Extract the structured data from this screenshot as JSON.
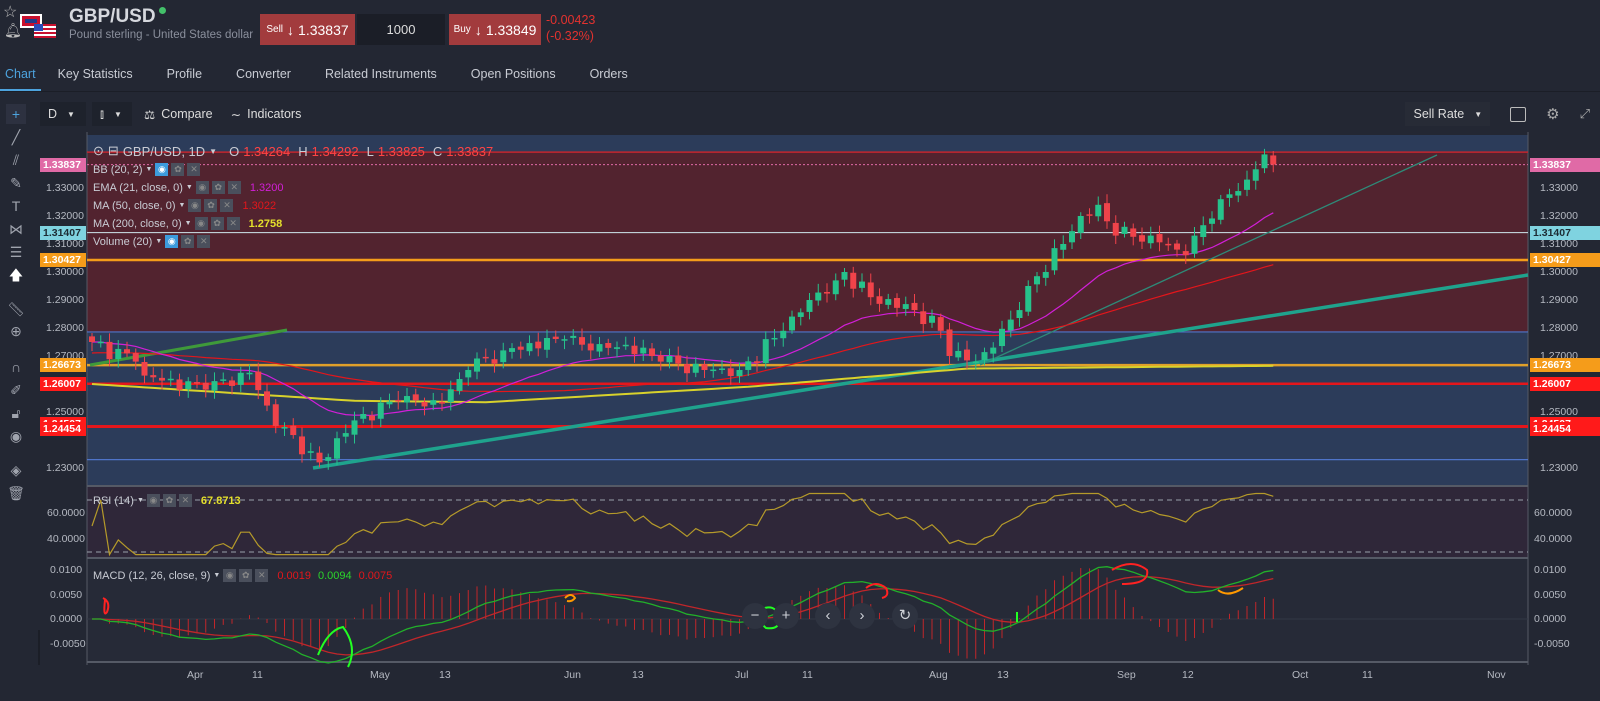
{
  "header": {
    "symbol": "GBP/USD",
    "name": "Pound sterling - United States dollar",
    "sell_label": "Sell",
    "sell_price": "1.33837",
    "quantity": "1000",
    "buy_label": "Buy",
    "buy_price": "1.33849",
    "change": "-0.00423",
    "change_pct": "(-0.32%)",
    "arrow": "↓"
  },
  "tabs": [
    "Chart",
    "Key Statistics",
    "Profile",
    "Converter",
    "Related Instruments",
    "Open Positions",
    "Orders"
  ],
  "toolbar": {
    "interval": "D",
    "compare": "Compare",
    "indicators": "Indicators",
    "rate": "Sell Rate"
  },
  "legend": {
    "title": "GBP/USD, 1D",
    "o_label": "O",
    "o": "1.34264",
    "h_label": "H",
    "h": "1.34292",
    "l_label": "L",
    "l": "1.33825",
    "c_label": "C",
    "c": "1.33837",
    "bb": "BB (20, 2)",
    "ema": "EMA (21, close, 0)",
    "ema_val": "1.3200",
    "ma50": "MA (50, close, 0)",
    "ma50_val": "1.3022",
    "ma200": "MA (200, close, 0)",
    "ma200_val": "1.2758",
    "volume": "Volume (20)",
    "rsi": "RSI (14)",
    "rsi_val": "67.8713",
    "macd": "MACD (12, 26, close, 9)",
    "macd_hist": "0.0019",
    "macd_line": "0.0094",
    "macd_signal": "0.0075"
  },
  "price_axis": [
    "1.33000",
    "1.32000",
    "1.31000",
    "1.30000",
    "1.29000",
    "1.28000",
    "1.27000",
    "1.25000",
    "1.23000"
  ],
  "price_tags": [
    {
      "text": "1.33837",
      "bg": "#e06aa6",
      "fg": "#fff"
    },
    {
      "text": "1.31407",
      "bg": "#7fd3e0",
      "fg": "#1c2b33"
    },
    {
      "text": "1.30427",
      "bg": "#f59c1a",
      "fg": "#fff"
    },
    {
      "text": "1.26673",
      "bg": "#f59c1a",
      "fg": "#fff"
    },
    {
      "text": "1.26007",
      "bg": "#ff1a1a",
      "fg": "#fff"
    },
    {
      "text": "1.24507",
      "bg": "#ff1a1a",
      "fg": "#fff"
    },
    {
      "text": "1.24454",
      "bg": "#ff1a1a",
      "fg": "#fff"
    }
  ],
  "rsi_axis": [
    "60.0000",
    "40.0000"
  ],
  "macd_axis": [
    "0.0100",
    "0.0050",
    "0.0000",
    "-0.0050"
  ],
  "x_axis": [
    "Apr",
    "11",
    "May",
    "13",
    "Jun",
    "13",
    "Jul",
    "11",
    "Aug",
    "13",
    "Sep",
    "12",
    "Oct",
    "11",
    "Nov"
  ],
  "colors": {
    "up": "#26c28b",
    "down": "#f0434a",
    "ema": "#d21fd8",
    "ma50": "#e3161b",
    "ma200": "#d8d22c",
    "rsi": "#b59a2a",
    "macd": "#22b02a",
    "signal": "#c0262a"
  },
  "chart_data": {
    "type": "candlestick",
    "symbol": "GBP/USD",
    "interval": "1D",
    "close_waypoints": [
      [
        0,
        1.275
      ],
      [
        5,
        1.268
      ],
      [
        6,
        1.263
      ],
      [
        13,
        1.258
      ],
      [
        18,
        1.264
      ],
      [
        21,
        1.245
      ],
      [
        25,
        1.236
      ],
      [
        26,
        1.232
      ],
      [
        30,
        1.247
      ],
      [
        35,
        1.254
      ],
      [
        40,
        1.253
      ],
      [
        43,
        1.265
      ],
      [
        47,
        1.272
      ],
      [
        54,
        1.276
      ],
      [
        57,
        1.272
      ],
      [
        61,
        1.274
      ],
      [
        65,
        1.268
      ],
      [
        70,
        1.265
      ],
      [
        74,
        1.265
      ],
      [
        79,
        1.279
      ],
      [
        82,
        1.29
      ],
      [
        85,
        1.297
      ],
      [
        86,
        1.3
      ],
      [
        89,
        1.291
      ],
      [
        94,
        1.2864
      ],
      [
        97,
        1.279
      ],
      [
        98,
        1.27
      ],
      [
        101,
        1.268
      ],
      [
        103,
        1.273
      ],
      [
        105,
        1.283
      ],
      [
        107,
        1.295
      ],
      [
        111,
        1.31
      ],
      [
        113,
        1.32
      ],
      [
        115,
        1.324
      ],
      [
        117,
        1.313
      ],
      [
        121,
        1.313
      ],
      [
        125,
        1.306
      ],
      [
        126,
        1.313
      ],
      [
        129,
        1.326
      ],
      [
        132,
        1.333
      ],
      [
        134,
        1.342
      ],
      [
        135,
        1.33837
      ]
    ],
    "ma200_waypoints": [
      [
        0,
        1.26
      ],
      [
        30,
        1.254
      ],
      [
        45,
        1.2535
      ],
      [
        75,
        1.259
      ],
      [
        100,
        1.2655
      ],
      [
        135,
        1.2665
      ]
    ],
    "levels": [
      1.3428,
      1.33837,
      1.31407,
      1.30427,
      1.2786,
      1.26673,
      1.26007,
      1.24507,
      1.24454,
      1.233
    ],
    "ylim": [
      1.2245,
      1.345
    ]
  }
}
